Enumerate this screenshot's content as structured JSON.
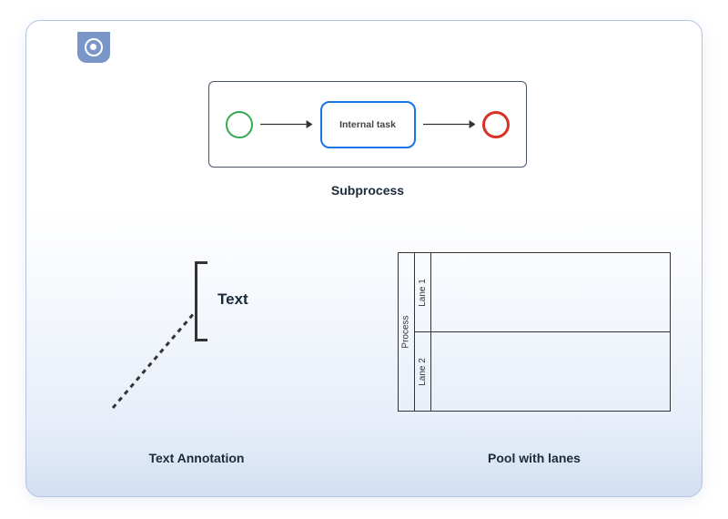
{
  "subprocess": {
    "task_label": "Internal task",
    "caption": "Subprocess"
  },
  "annotation": {
    "text": "Text",
    "caption": "Text Annotation"
  },
  "pool": {
    "header": "Process",
    "lanes": [
      "Lane 1",
      "Lane 2"
    ],
    "caption": "Pool with lanes"
  }
}
